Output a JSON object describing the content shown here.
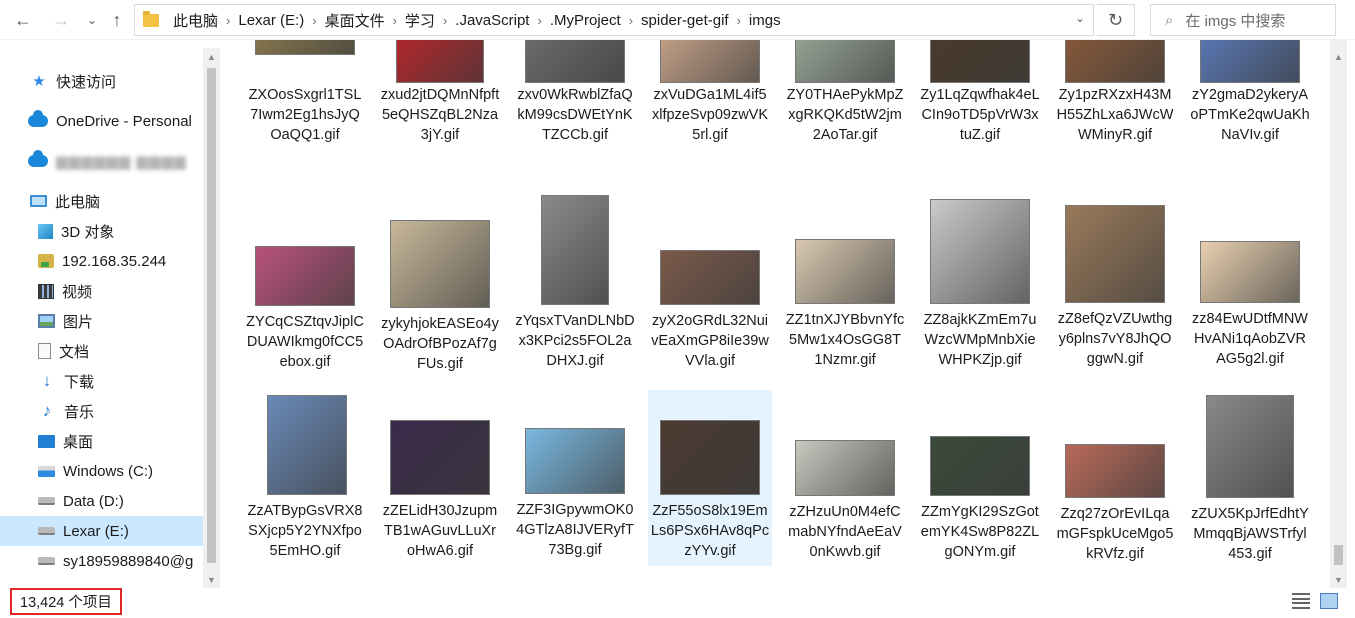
{
  "address": {
    "crumbs": [
      "此电脑",
      "Lexar (E:)",
      "桌面文件",
      "学习",
      ".JavaScript",
      ".MyProject",
      "spider-get-gif",
      "imgs"
    ],
    "separator": "›",
    "dropdown_icon": "chevron-down-icon"
  },
  "search": {
    "placeholder": "在 imgs 中搜索",
    "icon": "search-icon"
  },
  "sidebar": {
    "items": [
      {
        "label": "快速访问",
        "icon": "star-icon"
      },
      {
        "label": "OneDrive - Personal",
        "icon": "cloud-icon"
      },
      {
        "label": "blurred-account",
        "icon": "cloud-icon"
      },
      {
        "label": "此电脑",
        "icon": "computer-icon"
      },
      {
        "label": "3D 对象",
        "icon": "cube-icon"
      },
      {
        "label": "192.168.35.244",
        "icon": "network-drive-icon"
      },
      {
        "label": "视频",
        "icon": "video-icon"
      },
      {
        "label": "图片",
        "icon": "picture-icon"
      },
      {
        "label": "文档",
        "icon": "document-icon"
      },
      {
        "label": "下载",
        "icon": "download-icon"
      },
      {
        "label": "音乐",
        "icon": "music-icon"
      },
      {
        "label": "桌面",
        "icon": "desktop-icon"
      },
      {
        "label": "Windows (C:)",
        "icon": "windows-drive-icon"
      },
      {
        "label": "Data (D:)",
        "icon": "drive-icon"
      },
      {
        "label": "Lexar (E:)",
        "icon": "drive-icon",
        "selected": true
      },
      {
        "label": "sy18959889840@g",
        "icon": "drive-icon"
      }
    ]
  },
  "files": [
    {
      "name": "ZXOosSxgrl1TSL7Iwm2Eg1hsJyQOaQQ1.gif",
      "color": "#8a7a4e"
    },
    {
      "name": "zxud2jtDQMnNfpft5eQHSZqBL2Nza3jY.gif",
      "color": "#b8262c"
    },
    {
      "name": "zxv0WkRwblZfaQkM99csDWEtYnKTZCCb.gif",
      "color": "#6d6d6d"
    },
    {
      "name": "zxVuDGa1ML4if5xlfpzeSvp09zwVK5rl.gif",
      "color": "#c9a58a"
    },
    {
      "name": "ZY0THAePykMpZxgRKQKd5tW2jm2AoTar.gif",
      "color": "#9aa89a"
    },
    {
      "name": "Zy1LqZqwfhak4eLCIn9oTD5pVrW3xtuZ.gif",
      "color": "#4a3a2a"
    },
    {
      "name": "Zy1pzRXzxH43MH55ZhLxa6JWcWWMinyR.gif",
      "color": "#8a5a3a"
    },
    {
      "name": "zY2gmaD2ykeryAoPTmKe2qwUaKhNaVIv.gif",
      "color": "#5a7ab8"
    },
    {
      "name": "ZYCqCSZtqvJiplCDUAWIkmg0fCC5ebox.gif",
      "color": "#b8527a"
    },
    {
      "name": "zykyhjokEASEo4yOAdrOfBPozAf7gFUs.gif",
      "color": "#c8b89a"
    },
    {
      "name": "zYqsxTVanDLNbDx3KPci2s5FOL2aDHXJ.gif",
      "color": "#8a8a8a"
    },
    {
      "name": "zyX2oGRdL32NuivEaXmGP8iIe39wVVla.gif",
      "color": "#7a5a4a"
    },
    {
      "name": "ZZ1tnXJYBbvnYfc5Mw1x4OsGG8T1Nzmr.gif",
      "color": "#d8c8b0"
    },
    {
      "name": "ZZ8ajkKZmEm7uWzcWMpMnbXieWHPKZjp.gif",
      "color": "#cacaca"
    },
    {
      "name": "zZ8efQzVZUwthgy6plns7vY8JhQOggwN.gif",
      "color": "#9a7a5a"
    },
    {
      "name": "zz84EwUDtfMNWHvANi1qAobZVRAG5g2l.gif",
      "color": "#e8d0b0"
    },
    {
      "name": "ZzATBypGsVRX8SXjcp5Y2YNXfpo5EmHO.gif",
      "color": "#6a8ab8"
    },
    {
      "name": "zZELidH30JzupmTB1wAGuvLLuXroHwA6.gif",
      "color": "#3a2a4a"
    },
    {
      "name": "ZZF3IGpywmOK04GTlzA8IJVERyfT73Bg.gif",
      "color": "#7ab8e0"
    },
    {
      "name": "ZzF55oS8lx19EmLs6PSx6HAv8qPczYYv.gif",
      "color": "#4a3a30",
      "selected": true
    },
    {
      "name": "zZHzuUn0M4efCmabNYfndAeEaV0nKwvb.gif",
      "color": "#c8c8c0"
    },
    {
      "name": "ZZmYgKI29SzGotemYK4Sw8P82ZLgONYm.gif",
      "color": "#3a4a3a"
    },
    {
      "name": "Zzq27zOrEvILqamGFspkUceMgo5kRVfz.gif",
      "color": "#b86a5a"
    },
    {
      "name": "zZUX5KpJrfEdhtYMmqqBjAWSTrfyl453.gif",
      "color": "#8a8a8a"
    }
  ],
  "status": {
    "count": "13,424 个项目"
  }
}
